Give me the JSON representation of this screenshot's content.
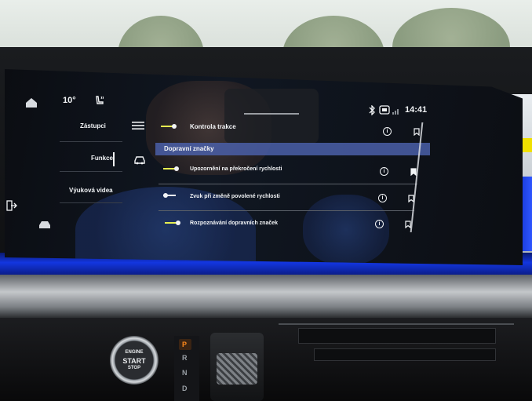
{
  "top_bar": {
    "temperature": "10°",
    "time": "14:41"
  },
  "nav": {
    "shortcuts_label": "Zástupci",
    "functions_label": "Funkce",
    "tutorial_videos_label": "Výuková videa"
  },
  "settings": {
    "traction_control": {
      "label": "Kontrola trakce",
      "enabled": true
    },
    "section_title": "Dopravní značky",
    "items": [
      {
        "label": "Upozornění na překročení rychlosti",
        "enabled": true,
        "bookmarked": true
      },
      {
        "label": "Zvuk při změně povolené rychlosti",
        "enabled": false,
        "bookmarked": false
      },
      {
        "label": "Rozpoznávání dopravních značek",
        "enabled": true,
        "bookmarked": false
      }
    ]
  },
  "icons": {
    "home": "home-icon",
    "seat": "seat-heating-icon",
    "menu": "hamburger-menu-icon",
    "car": "car-icon",
    "exit": "exit-icon",
    "bluetooth": "bluetooth-icon",
    "phone": "phone-connection-icon",
    "signal": "signal-icon",
    "info": "info-icon",
    "bookmark": "bookmark-icon"
  },
  "colors": {
    "toggle_on": "#e7ef50",
    "section_highlight": "#4a5fa8",
    "ambient_light": "#1336e0"
  },
  "physical_controls": {
    "start_button_line1": "ENGINE",
    "start_button_line2": "START",
    "start_button_line3": "STOP",
    "gear_p": "P",
    "gear_r": "R",
    "gear_n": "N",
    "gear_d": "D"
  }
}
